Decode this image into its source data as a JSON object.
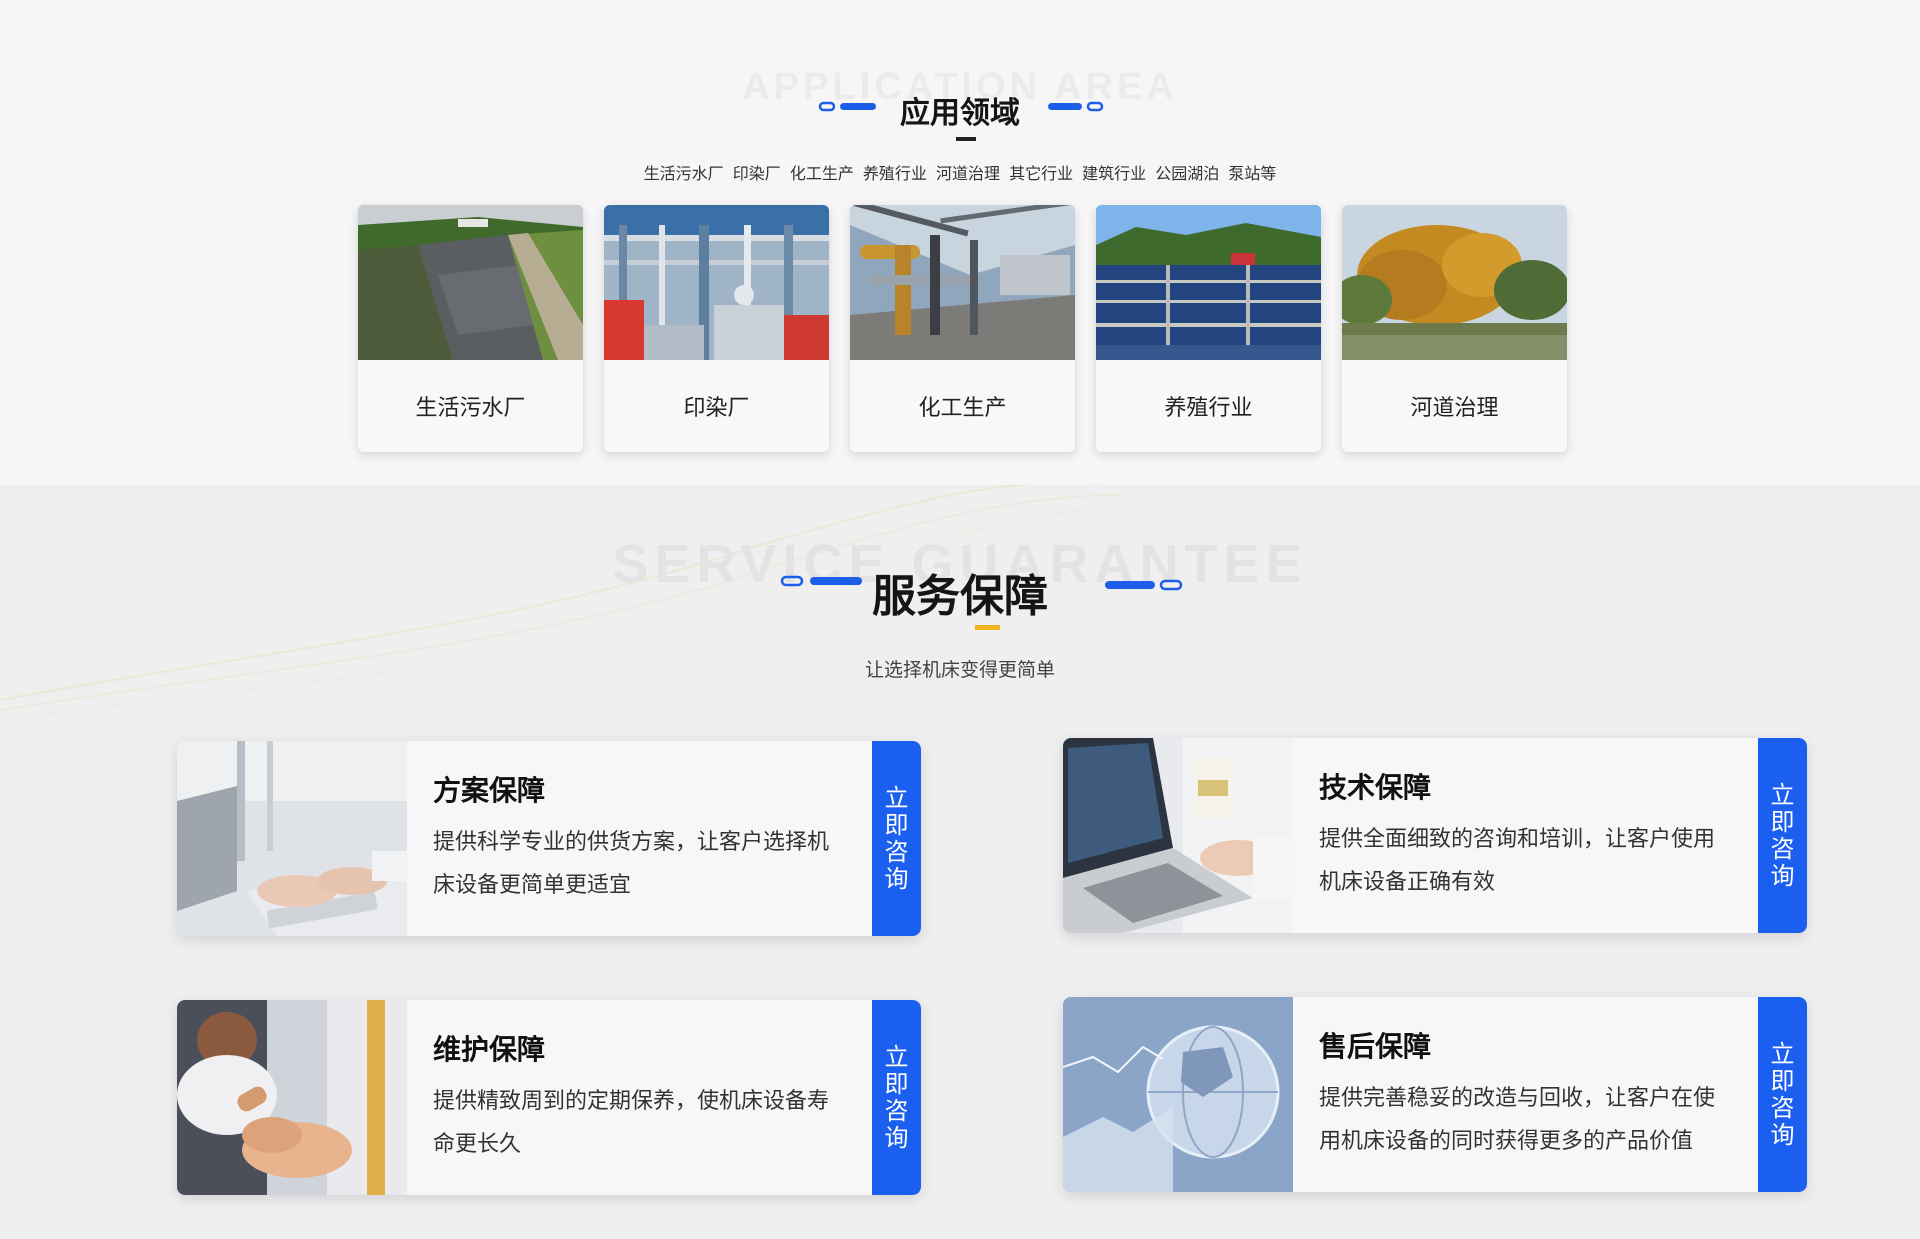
{
  "application": {
    "bg_word": "APPLICATION AREA",
    "title": "应用领域",
    "subtitle": "生活污水厂 印染厂 化工生产 养殖行业 河道治理 其它行业 建筑行业 公园湖泊 泵站等",
    "cards": [
      {
        "label": "生活污水厂",
        "image": "river-canal-photo"
      },
      {
        "label": "印染厂",
        "image": "dyeing-factory-pipes-photo"
      },
      {
        "label": "化工生产",
        "image": "chemical-plant-pipes-photo"
      },
      {
        "label": "养殖行业",
        "image": "aquaculture-ponds-photo"
      },
      {
        "label": "河道治理",
        "image": "autumn-trees-river-photo"
      }
    ]
  },
  "service": {
    "bg_word": "SERVICE GUARANTEE",
    "title": "服务保障",
    "subtitle": "让选择机床变得更简单",
    "cards": [
      {
        "title": "方案保障",
        "desc": "提供科学专业的供货方案，让客户选择机床设备更简单更适宜",
        "button": "立即咨询",
        "image": "office-keyboard-photo"
      },
      {
        "title": "技术保障",
        "desc": "提供全面细致的咨询和培训，让客户使用机床设备正确有效",
        "button": "立即咨询",
        "image": "laptop-coffee-photo"
      },
      {
        "title": "维护保障",
        "desc": "提供精致周到的定期保养，使机床设备寿命更长久",
        "button": "立即咨询",
        "image": "handshake-photo"
      },
      {
        "title": "售后保障",
        "desc": "提供完善稳妥的改造与回收，让客户在使用机床设备的同时获得更多的产品价值",
        "button": "立即咨询",
        "image": "globe-data-photo"
      }
    ]
  },
  "colors": {
    "accent_blue": "#1c5ee8",
    "button_blue": "#1a5ff0",
    "accent_yellow": "#f2b21c",
    "title_dark": "#151515"
  }
}
